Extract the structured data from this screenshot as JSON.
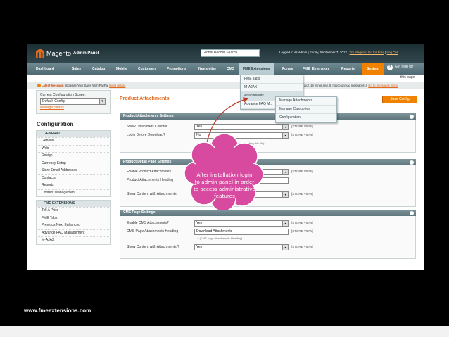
{
  "footer": {
    "url": "www.fmeextensions.com"
  },
  "header": {
    "logo_text": "Magento",
    "logo_sub": "Admin Panel",
    "global_search": "Global Record Search",
    "logged_in": "Logged in as admin",
    "date": "Friday, September 7, 2012",
    "try_link": "Try Magento Go for Free",
    "logout": "Log Out"
  },
  "nav": {
    "items": [
      "Dashboard",
      "Sales",
      "Catalog",
      "Mobile",
      "Customers",
      "Promotions",
      "Newsletter",
      "CMS",
      "FME Extensions",
      "Forms",
      "FME_Extension",
      "Reports",
      "System"
    ],
    "help": "Get help for",
    "help_sub": "this page"
  },
  "notice": {
    "label": "Latest Message:",
    "text": "Increase Your Sales With PayPal",
    "link": "Read details",
    "right_text": "ajor, 19 minor and 48 notice unread message(s).",
    "right_link": "Go to messages inbox"
  },
  "sidebar": {
    "scope_label": "Current Configuration Scope:",
    "scope_value": "Default Config",
    "manage_stores": "Manage Stores",
    "config_title": "Configuration",
    "general_head": "GENERAL",
    "general_items": [
      "General",
      "Web",
      "Design",
      "Currency Setup",
      "Store Email Addresses",
      "Contacts",
      "Reports",
      "Content Management"
    ],
    "fme_head": "FME EXTENSIONS",
    "fme_items": [
      "Tell A Price",
      "FME Tabs",
      "Previous Next Enhanced",
      "Advance FAQ Management",
      "M-AJAX"
    ]
  },
  "main": {
    "title": "Product Attachments",
    "save_button": "Save Config",
    "sections": [
      {
        "title": "Product Attachments Settings",
        "rows": [
          {
            "label": "Show Downloads Counter",
            "value": "Yes",
            "scope": "[STORE VIEW]"
          },
          {
            "label": "Login Before Download?",
            "value": "No",
            "scope": "[STORE VIEW]"
          }
        ],
        "note": "+ User must be logged in before downloading this file)"
      },
      {
        "title": "Product Detail Page Settings",
        "rows": [
          {
            "label": "Enable Product Attachments",
            "value": "",
            "scope": "[STORE VIEW]"
          },
          {
            "label": "Product Attachments Heading",
            "value": "",
            "scope": ""
          },
          {
            "label": "Show Content with Attachments",
            "value": "",
            "scope": "[STORE VIEW]"
          }
        ]
      },
      {
        "title": "CMS Page Settings",
        "rows": [
          {
            "label": "Enable CMS Attachments?",
            "value": "Yes",
            "scope": "[STORE VIEW]"
          },
          {
            "label": "CMS Page Attachments Heading",
            "value": "Download Attachments",
            "scope": "[STORE VIEW]"
          },
          {
            "label": "Show Content with Attachments ?",
            "value": "Yes",
            "scope": "[STORE VIEW]"
          }
        ],
        "note": "+ (CMS page Attachments Heading)"
      }
    ]
  },
  "menu": {
    "items": [
      "FME Tabs",
      "M-AJAX",
      "Attachments",
      "Advance FAQ M..."
    ],
    "submenu": [
      "Manage Attachments",
      "Manage Categories",
      "Configuration"
    ]
  },
  "callout": {
    "line1": "After installation login",
    "line2": "to admin panel in order",
    "line3": "to access administrative",
    "line4": "features"
  }
}
